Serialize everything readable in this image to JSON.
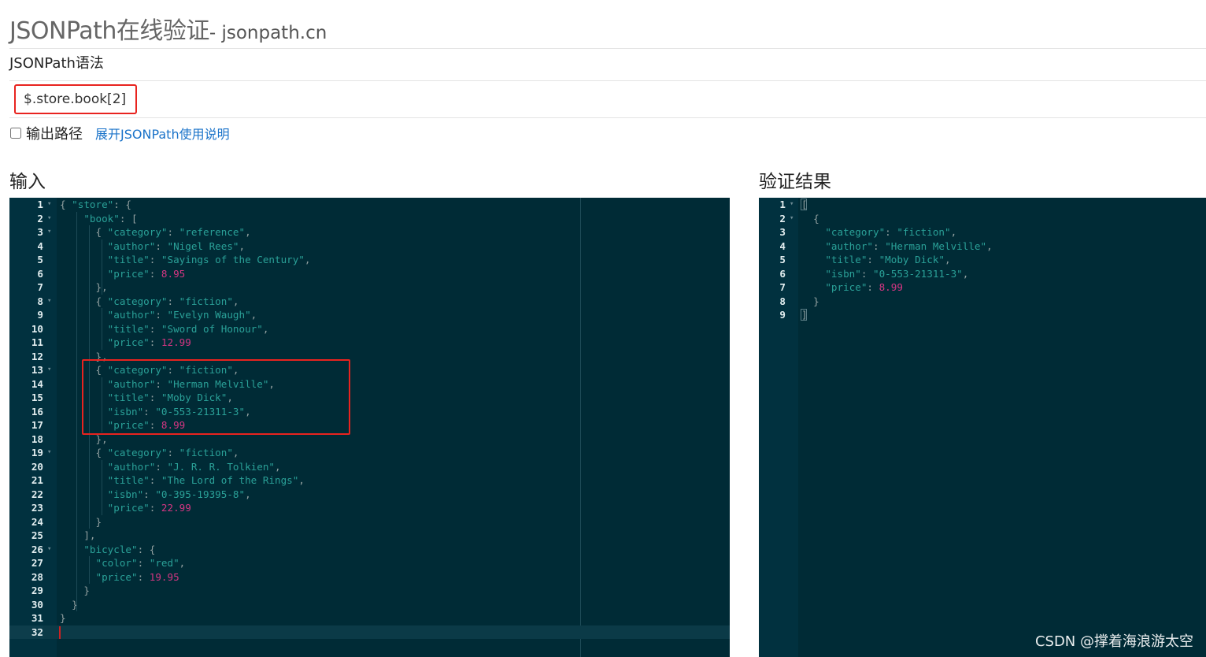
{
  "header": {
    "title_main": "JSONPath在线验证",
    "title_sub": "- jsonpath.cn",
    "syntax_label": "JSONPath语法"
  },
  "query": {
    "value": "$.store.book[2]"
  },
  "options": {
    "output_path_label": "输出路径",
    "help_link": "展开JSONPath使用说明"
  },
  "input_panel": {
    "heading": "输入",
    "lines": [
      [
        [
          "p",
          "{ "
        ],
        [
          "k",
          "\"store\""
        ],
        [
          "p",
          ": {"
        ]
      ],
      [
        [
          "p",
          "    "
        ],
        [
          "k",
          "\"book\""
        ],
        [
          "p",
          ": ["
        ]
      ],
      [
        [
          "p",
          "      { "
        ],
        [
          "k",
          "\"category\""
        ],
        [
          "p",
          ": "
        ],
        [
          "s",
          "\"reference\""
        ],
        [
          "p",
          ","
        ]
      ],
      [
        [
          "p",
          "        "
        ],
        [
          "k",
          "\"author\""
        ],
        [
          "p",
          ": "
        ],
        [
          "s",
          "\"Nigel Rees\""
        ],
        [
          "p",
          ","
        ]
      ],
      [
        [
          "p",
          "        "
        ],
        [
          "k",
          "\"title\""
        ],
        [
          "p",
          ": "
        ],
        [
          "s",
          "\"Sayings of the Century\""
        ],
        [
          "p",
          ","
        ]
      ],
      [
        [
          "p",
          "        "
        ],
        [
          "k",
          "\"price\""
        ],
        [
          "p",
          ": "
        ],
        [
          "n",
          "8.95"
        ]
      ],
      [
        [
          "p",
          "      },"
        ]
      ],
      [
        [
          "p",
          "      { "
        ],
        [
          "k",
          "\"category\""
        ],
        [
          "p",
          ": "
        ],
        [
          "s",
          "\"fiction\""
        ],
        [
          "p",
          ","
        ]
      ],
      [
        [
          "p",
          "        "
        ],
        [
          "k",
          "\"author\""
        ],
        [
          "p",
          ": "
        ],
        [
          "s",
          "\"Evelyn Waugh\""
        ],
        [
          "p",
          ","
        ]
      ],
      [
        [
          "p",
          "        "
        ],
        [
          "k",
          "\"title\""
        ],
        [
          "p",
          ": "
        ],
        [
          "s",
          "\"Sword of Honour\""
        ],
        [
          "p",
          ","
        ]
      ],
      [
        [
          "p",
          "        "
        ],
        [
          "k",
          "\"price\""
        ],
        [
          "p",
          ": "
        ],
        [
          "n",
          "12.99"
        ]
      ],
      [
        [
          "p",
          "      },"
        ]
      ],
      [
        [
          "p",
          "      { "
        ],
        [
          "k",
          "\"category\""
        ],
        [
          "p",
          ": "
        ],
        [
          "s",
          "\"fiction\""
        ],
        [
          "p",
          ","
        ]
      ],
      [
        [
          "p",
          "        "
        ],
        [
          "k",
          "\"author\""
        ],
        [
          "p",
          ": "
        ],
        [
          "s",
          "\"Herman Melville\""
        ],
        [
          "p",
          ","
        ]
      ],
      [
        [
          "p",
          "        "
        ],
        [
          "k",
          "\"title\""
        ],
        [
          "p",
          ": "
        ],
        [
          "s",
          "\"Moby Dick\""
        ],
        [
          "p",
          ","
        ]
      ],
      [
        [
          "p",
          "        "
        ],
        [
          "k",
          "\"isbn\""
        ],
        [
          "p",
          ": "
        ],
        [
          "s",
          "\"0-553-21311-3\""
        ],
        [
          "p",
          ","
        ]
      ],
      [
        [
          "p",
          "        "
        ],
        [
          "k",
          "\"price\""
        ],
        [
          "p",
          ": "
        ],
        [
          "n",
          "8.99"
        ]
      ],
      [
        [
          "p",
          "      },"
        ]
      ],
      [
        [
          "p",
          "      { "
        ],
        [
          "k",
          "\"category\""
        ],
        [
          "p",
          ": "
        ],
        [
          "s",
          "\"fiction\""
        ],
        [
          "p",
          ","
        ]
      ],
      [
        [
          "p",
          "        "
        ],
        [
          "k",
          "\"author\""
        ],
        [
          "p",
          ": "
        ],
        [
          "s",
          "\"J. R. R. Tolkien\""
        ],
        [
          "p",
          ","
        ]
      ],
      [
        [
          "p",
          "        "
        ],
        [
          "k",
          "\"title\""
        ],
        [
          "p",
          ": "
        ],
        [
          "s",
          "\"The Lord of the Rings\""
        ],
        [
          "p",
          ","
        ]
      ],
      [
        [
          "p",
          "        "
        ],
        [
          "k",
          "\"isbn\""
        ],
        [
          "p",
          ": "
        ],
        [
          "s",
          "\"0-395-19395-8\""
        ],
        [
          "p",
          ","
        ]
      ],
      [
        [
          "p",
          "        "
        ],
        [
          "k",
          "\"price\""
        ],
        [
          "p",
          ": "
        ],
        [
          "n",
          "22.99"
        ]
      ],
      [
        [
          "p",
          "      }"
        ]
      ],
      [
        [
          "p",
          "    ],"
        ]
      ],
      [
        [
          "p",
          "    "
        ],
        [
          "k",
          "\"bicycle\""
        ],
        [
          "p",
          ": {"
        ]
      ],
      [
        [
          "p",
          "      "
        ],
        [
          "k",
          "\"color\""
        ],
        [
          "p",
          ": "
        ],
        [
          "s",
          "\"red\""
        ],
        [
          "p",
          ","
        ]
      ],
      [
        [
          "p",
          "      "
        ],
        [
          "k",
          "\"price\""
        ],
        [
          "p",
          ": "
        ],
        [
          "n",
          "19.95"
        ]
      ],
      [
        [
          "p",
          "    }"
        ]
      ],
      [
        [
          "p",
          "  }"
        ]
      ],
      [
        [
          "p",
          "}"
        ]
      ],
      [
        [
          "p",
          ""
        ]
      ]
    ],
    "fold_lines": [
      1,
      2,
      3,
      8,
      13,
      19,
      26
    ]
  },
  "result_panel": {
    "heading": "验证结果",
    "lines": [
      [
        [
          "p",
          "["
        ]
      ],
      [
        [
          "p",
          "  {"
        ]
      ],
      [
        [
          "p",
          "    "
        ],
        [
          "k",
          "\"category\""
        ],
        [
          "p",
          ": "
        ],
        [
          "s",
          "\"fiction\""
        ],
        [
          "p",
          ","
        ]
      ],
      [
        [
          "p",
          "    "
        ],
        [
          "k",
          "\"author\""
        ],
        [
          "p",
          ": "
        ],
        [
          "s",
          "\"Herman Melville\""
        ],
        [
          "p",
          ","
        ]
      ],
      [
        [
          "p",
          "    "
        ],
        [
          "k",
          "\"title\""
        ],
        [
          "p",
          ": "
        ],
        [
          "s",
          "\"Moby Dick\""
        ],
        [
          "p",
          ","
        ]
      ],
      [
        [
          "p",
          "    "
        ],
        [
          "k",
          "\"isbn\""
        ],
        [
          "p",
          ": "
        ],
        [
          "s",
          "\"0-553-21311-3\""
        ],
        [
          "p",
          ","
        ]
      ],
      [
        [
          "p",
          "    "
        ],
        [
          "k",
          "\"price\""
        ],
        [
          "p",
          ": "
        ],
        [
          "n",
          "8.99"
        ]
      ],
      [
        [
          "p",
          "  }"
        ]
      ],
      [
        [
          "p",
          "]"
        ]
      ]
    ],
    "fold_lines": [
      1,
      2
    ]
  },
  "watermark": "CSDN @撑着海浪游太空",
  "colors": {
    "editor_bg": "#002b36",
    "json_key": "#2aa198",
    "json_string": "#2aa198",
    "json_number": "#d33682",
    "annotation_red": "#e8231f",
    "link_blue": "#1a73c9"
  }
}
